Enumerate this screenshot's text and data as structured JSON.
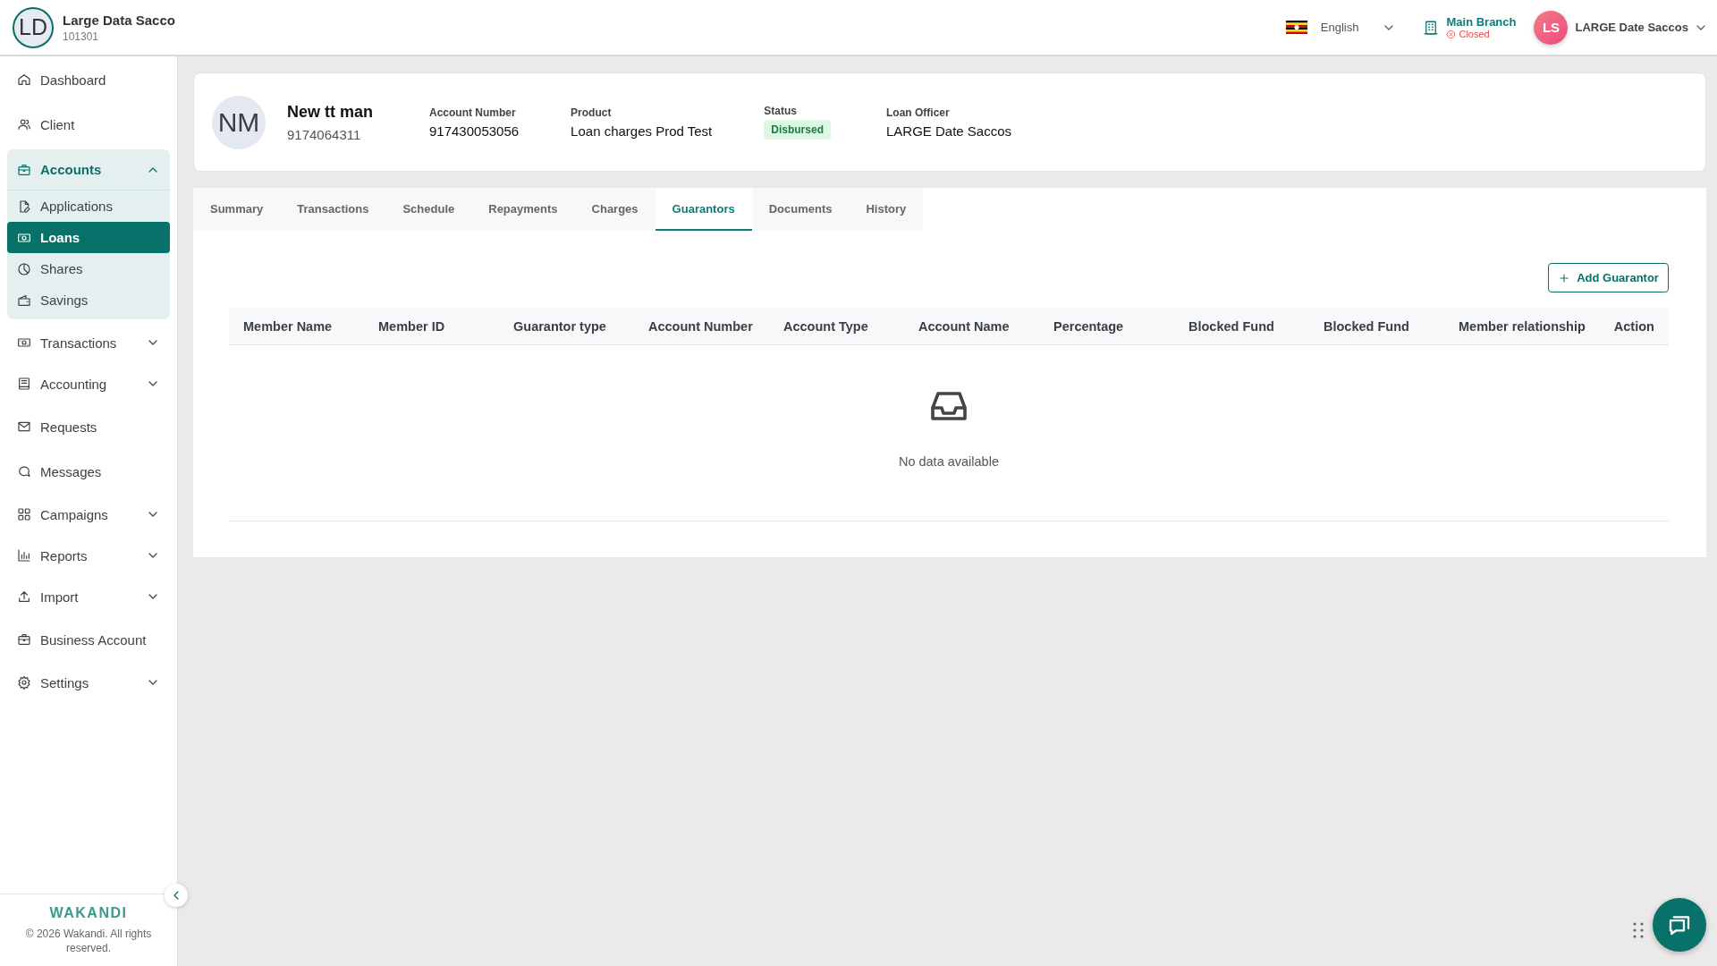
{
  "header": {
    "org_initials": "LD",
    "org_name": "Large Data Sacco",
    "org_code": "101301",
    "language": "English",
    "branch": {
      "name": "Main Branch",
      "status": "Closed"
    },
    "user": {
      "initials": "LS",
      "name": "LARGE Date Saccos"
    }
  },
  "sidebar": {
    "items": [
      {
        "label": "Dashboard",
        "kind": "link"
      },
      {
        "label": "Client",
        "kind": "link"
      },
      {
        "label": "Accounts",
        "kind": "menu",
        "expanded": true,
        "children": [
          {
            "label": "Applications",
            "selected": false
          },
          {
            "label": "Loans",
            "selected": true
          },
          {
            "label": "Shares",
            "selected": false
          },
          {
            "label": "Savings",
            "selected": false
          }
        ]
      },
      {
        "label": "Transactions",
        "kind": "menu",
        "expanded": false
      },
      {
        "label": "Accounting",
        "kind": "menu",
        "expanded": false
      },
      {
        "label": "Requests",
        "kind": "link"
      },
      {
        "label": "Messages",
        "kind": "link"
      },
      {
        "label": "Campaigns",
        "kind": "menu",
        "expanded": false
      },
      {
        "label": "Reports",
        "kind": "menu",
        "expanded": false
      },
      {
        "label": "Import",
        "kind": "menu",
        "expanded": false
      },
      {
        "label": "Business Account",
        "kind": "link"
      },
      {
        "label": "Settings",
        "kind": "menu",
        "expanded": false
      }
    ],
    "brand": "WAKANDI",
    "copyright": "© 2026 Wakandi. All rights reserved."
  },
  "loan": {
    "initials": "NM",
    "name": "New tt man",
    "client_id": "9174064311",
    "fields": [
      {
        "label": "Account Number",
        "value": "917430053056",
        "kind": "text"
      },
      {
        "label": "Product",
        "value": "Loan charges Prod Test",
        "kind": "text"
      },
      {
        "label": "Status",
        "value": "Disbursed",
        "kind": "badge"
      },
      {
        "label": "Loan Officer",
        "value": "LARGE Date Saccos",
        "kind": "text"
      }
    ]
  },
  "tabs": [
    {
      "label": "Summary",
      "selected": false
    },
    {
      "label": "Transactions",
      "selected": false
    },
    {
      "label": "Schedule",
      "selected": false
    },
    {
      "label": "Repayments",
      "selected": false
    },
    {
      "label": "Charges",
      "selected": false
    },
    {
      "label": "Guarantors",
      "selected": true
    },
    {
      "label": "Documents",
      "selected": false
    },
    {
      "label": "History",
      "selected": false
    }
  ],
  "guarantors": {
    "add_button": "Add Guarantor",
    "columns": [
      "Member Name",
      "Member ID",
      "Guarantor type",
      "Account Number",
      "Account Type",
      "Account Name",
      "Percentage",
      "Blocked Fund",
      "Blocked Fund",
      "Member relationship",
      "Action"
    ],
    "empty_text": "No data available"
  }
}
